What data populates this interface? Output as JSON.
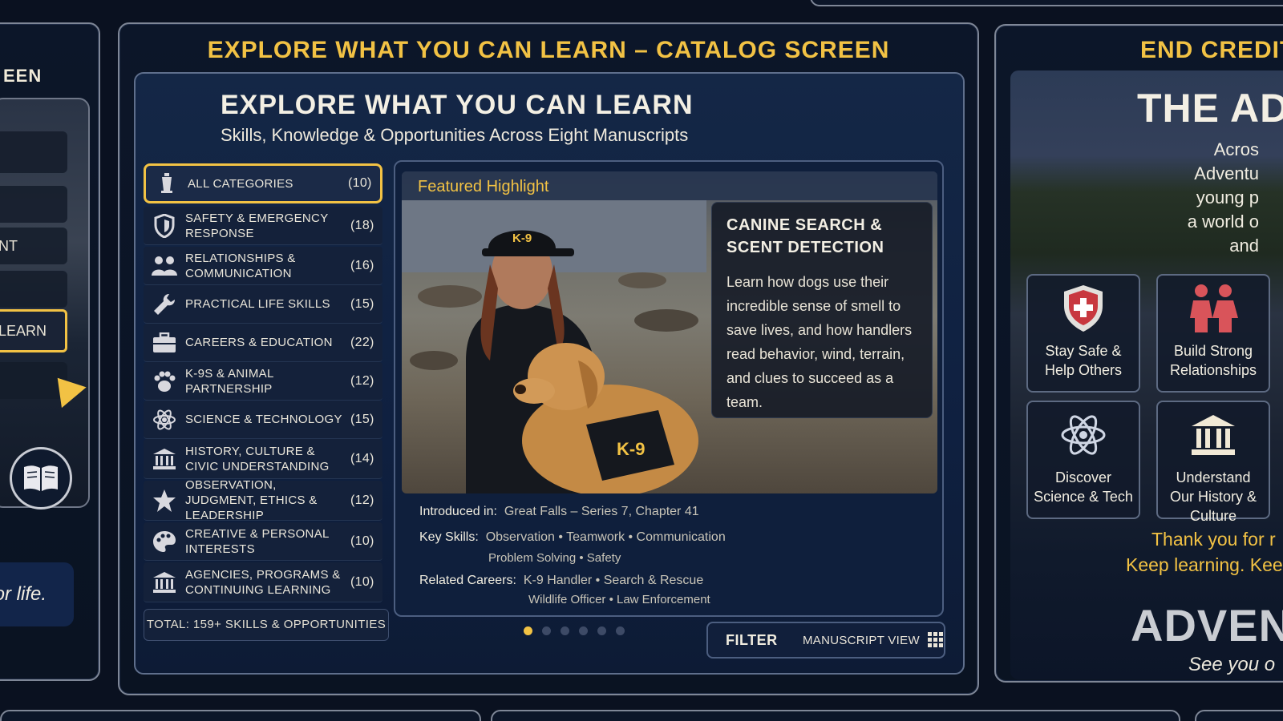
{
  "left_panel": {
    "title_fragment": "EEN",
    "menu_items": [
      {
        "label": ""
      },
      {
        "label": ""
      },
      {
        "label": "NT"
      },
      {
        "label": ""
      },
      {
        "label": "LEARN"
      },
      {
        "label": ""
      }
    ],
    "tagline": "for life."
  },
  "main_panel": {
    "screen_label": "EXPLORE WHAT YOU CAN LEARN – CATALOG SCREEN",
    "heading": "EXPLORE WHAT YOU CAN LEARN",
    "subheading": "Skills, Knowledge & Opportunities Across Eight Manuscripts",
    "categories": [
      {
        "label": "All Categories",
        "count": "(10)",
        "icon": "lantern-icon",
        "active": true
      },
      {
        "label": "Safety & Emergency Response",
        "count": "(18)",
        "icon": "shield-icon"
      },
      {
        "label": "Relationships & Communication",
        "count": "(16)",
        "icon": "people-icon"
      },
      {
        "label": "Practical Life Skills",
        "count": "(15)",
        "icon": "wrench-icon"
      },
      {
        "label": "Careers & Education",
        "count": "(22)",
        "icon": "briefcase-icon"
      },
      {
        "label": "K-9s & Animal Partnership",
        "count": "(12)",
        "icon": "paw-icon"
      },
      {
        "label": "Science & Technology",
        "count": "(15)",
        "icon": "atom-icon"
      },
      {
        "label": "History, Culture & Civic Understanding",
        "count": "(14)",
        "icon": "museum-icon"
      },
      {
        "label": "Observation, Judgment, Ethics & Leadership",
        "count": "(12)",
        "icon": "star-icon"
      },
      {
        "label": "Creative & Personal Interests",
        "count": "(10)",
        "icon": "palette-icon"
      },
      {
        "label": "Agencies, Programs & Continuing Learning",
        "count": "(10)",
        "icon": "building-icon"
      }
    ],
    "total": "TOTAL: 159+ SKILLS & OPPORTUNITIES",
    "featured": {
      "label": "Featured Highlight",
      "photo_caption_badge": "K-9",
      "title": "CANINE SEARCH & SCENT DETECTION",
      "body": "Learn how dogs use their incredible sense of smell to save lives, and how handlers read behavior, wind, terrain, and clues to succeed as a team.",
      "introduced_key": "Introduced in:",
      "introduced_val": "Great Falls – Series 7, Chapter 41",
      "skills_key": "Key Skills:",
      "skills_line1": "Observation  •  Teamwork  •  Communication",
      "skills_line2": "Problem Solving  •  Safety",
      "careers_key": "Related Careers:",
      "careers_line1": "K-9 Handler  •  Search & Rescue",
      "careers_line2": "Wildlife Officer  •  Law Enforcement"
    },
    "pagination": {
      "total": 6,
      "active": 0
    },
    "controls": {
      "filter": "FILTER",
      "manuscript_view": "Manuscript View"
    }
  },
  "right_panel": {
    "screen_label": "END CREDITS -",
    "big_title": "THE ADVE",
    "intro_lines": [
      "Acros",
      "Adventu",
      "young p",
      "a world o",
      "and"
    ],
    "tiles": [
      {
        "label": "Stay Safe & Help Others",
        "icon": "shield-cross-icon"
      },
      {
        "label": "Build Strong Relationships",
        "icon": "people-icon"
      },
      {
        "label": "Discover Science & Tech",
        "icon": "atom-icon"
      },
      {
        "label": "Understand Our History & Culture",
        "icon": "museum-icon"
      }
    ],
    "thanks_line1": "Thank you for r",
    "thanks_line2": "Keep learning. Kee",
    "brand": "ADVENT",
    "see_you": "See you o"
  },
  "colors": {
    "accent": "#f2c244",
    "background": "#0a1120",
    "panel": "#142746"
  }
}
